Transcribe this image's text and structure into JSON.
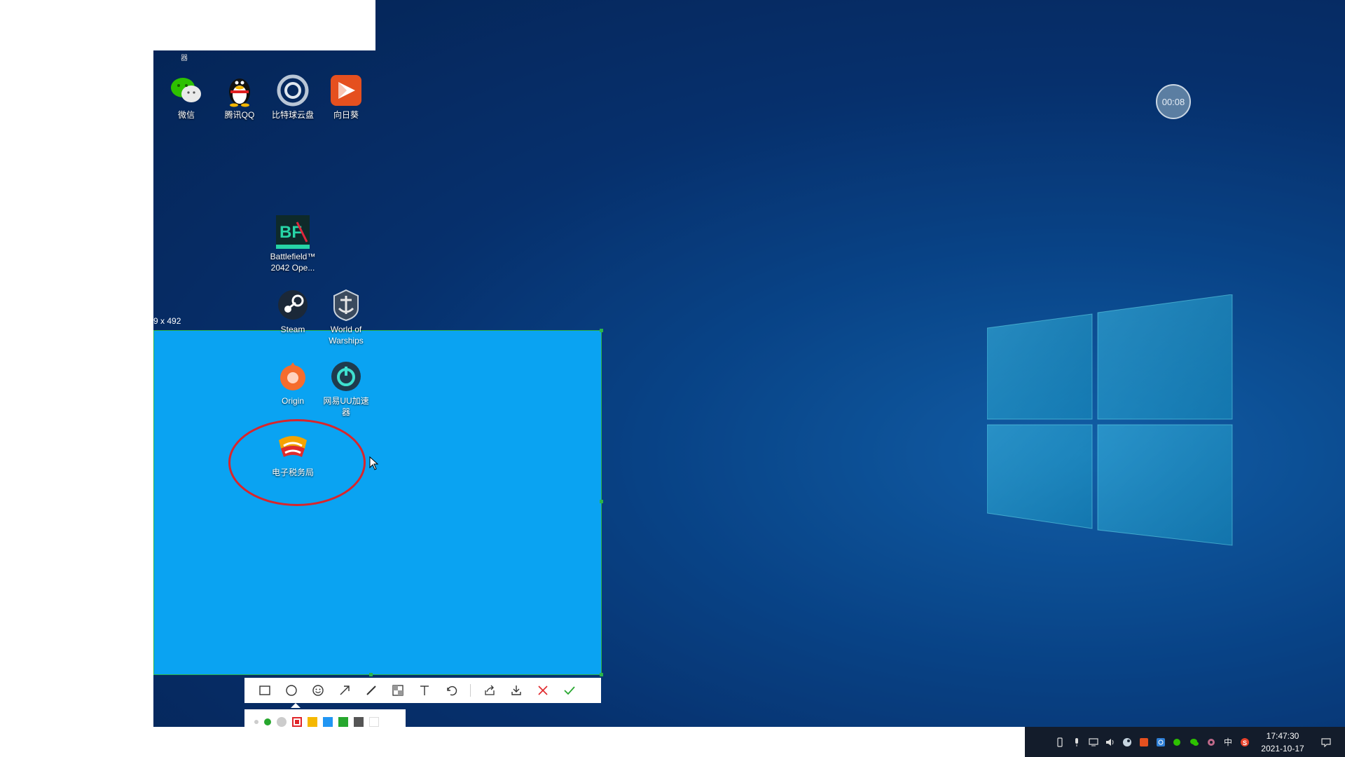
{
  "desktop_icons": [
    {
      "label": "微信",
      "icon": "wechat-icon"
    },
    {
      "label": "腾讯QQ",
      "icon": "qq-penguin-icon"
    },
    {
      "label": "比特球云盘",
      "icon": "cloud-disk-icon"
    },
    {
      "label": "向日葵",
      "icon": "sunflower-remote-icon"
    },
    {
      "label": "Battlefield™ 2042 Ope...",
      "icon": "battlefield-icon"
    },
    {
      "label": "Steam",
      "icon": "steam-icon"
    },
    {
      "label": "World of Warships",
      "icon": "world-of-warships-icon"
    },
    {
      "label": "Origin",
      "icon": "origin-icon"
    },
    {
      "label": "网易UU加速器",
      "icon": "uu-accelerator-icon"
    },
    {
      "label": "电子税务局",
      "icon": "tax-bureau-icon"
    }
  ],
  "partial_top_label": "器",
  "selection": {
    "size_label": "9 x 492"
  },
  "toolbar": {
    "tools": [
      "rectangle-icon",
      "ellipse-icon",
      "emoji-icon",
      "arrow-icon",
      "pen-icon",
      "mosaic-icon",
      "text-icon",
      "undo-icon",
      "share-icon",
      "download-icon",
      "cancel-icon",
      "confirm-icon"
    ]
  },
  "palette": {
    "sizes": [
      "small",
      "medium",
      "large"
    ],
    "colors": [
      "#e0262a",
      "#f5b800",
      "#2196f3",
      "#27a72e",
      "#555555",
      "#ffffff"
    ],
    "selected_color": "#e0262a"
  },
  "timer": {
    "label": "00:08"
  },
  "taskbar": {
    "time": "17:47:30",
    "date": "2021-10-17",
    "ime": "中",
    "tray_icons": [
      "usb-icon",
      "microphone-icon",
      "network-icon",
      "volume-icon",
      "steam-tray-icon",
      "sunflower-tray-icon",
      "cloud-tray-icon",
      "wechat-tray-icon",
      "wechat-tray-icon-2",
      "gear-tray-icon",
      "ime-icon",
      "sogou-icon"
    ]
  },
  "colors": {
    "selection_border": "#2bb34a",
    "annotation": "#d9252b",
    "selection_fill": "#0aa3f2"
  }
}
